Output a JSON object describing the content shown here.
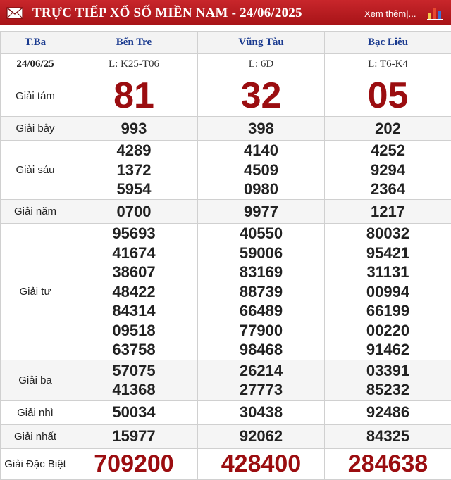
{
  "header": {
    "title": "TRỰC TIẾP XỔ SỐ MIỀN NAM - 24/06/2025",
    "more_link": "Xem thêm|...",
    "mail_icon": "mail-icon",
    "chart_icon": "bar-chart-icon",
    "background": "#b51c20"
  },
  "table": {
    "day_header": "T.Ba",
    "date": "24/06/25",
    "provinces": [
      {
        "name": "Bến Tre",
        "code": "L: K25-T06"
      },
      {
        "name": "Vũng Tàu",
        "code": "L: 6D"
      },
      {
        "name": "Bạc Liêu",
        "code": "L: T6-K4"
      }
    ],
    "prizes": [
      {
        "label": "Giải tám",
        "values": [
          [
            "81"
          ],
          [
            "32"
          ],
          [
            "05"
          ]
        ]
      },
      {
        "label": "Giải bảy",
        "values": [
          [
            "993"
          ],
          [
            "398"
          ],
          [
            "202"
          ]
        ]
      },
      {
        "label": "Giải sáu",
        "values": [
          [
            "4289",
            "1372",
            "5954"
          ],
          [
            "4140",
            "4509",
            "0980"
          ],
          [
            "4252",
            "9294",
            "2364"
          ]
        ]
      },
      {
        "label": "Giải năm",
        "values": [
          [
            "0700"
          ],
          [
            "9977"
          ],
          [
            "1217"
          ]
        ]
      },
      {
        "label": "Giải tư",
        "values": [
          [
            "95693",
            "41674",
            "38607",
            "48422",
            "84314",
            "09518",
            "63758"
          ],
          [
            "40550",
            "59006",
            "83169",
            "88739",
            "66489",
            "77900",
            "98468"
          ],
          [
            "80032",
            "95421",
            "31131",
            "00994",
            "66199",
            "00220",
            "91462"
          ]
        ]
      },
      {
        "label": "Giải ba",
        "values": [
          [
            "57075",
            "41368"
          ],
          [
            "26214",
            "27773"
          ],
          [
            "03391",
            "85232"
          ]
        ]
      },
      {
        "label": "Giải nhì",
        "values": [
          [
            "50034"
          ],
          [
            "30438"
          ],
          [
            "92486"
          ]
        ]
      },
      {
        "label": "Giải nhất",
        "values": [
          [
            "15977"
          ],
          [
            "92062"
          ],
          [
            "84325"
          ]
        ]
      },
      {
        "label": "Giải Đặc Biệt",
        "values": [
          [
            "709200"
          ],
          [
            "428400"
          ],
          [
            "284638"
          ]
        ]
      }
    ],
    "header_text_color": "#1a3a8f",
    "highlight_color": "#9b0d10"
  }
}
